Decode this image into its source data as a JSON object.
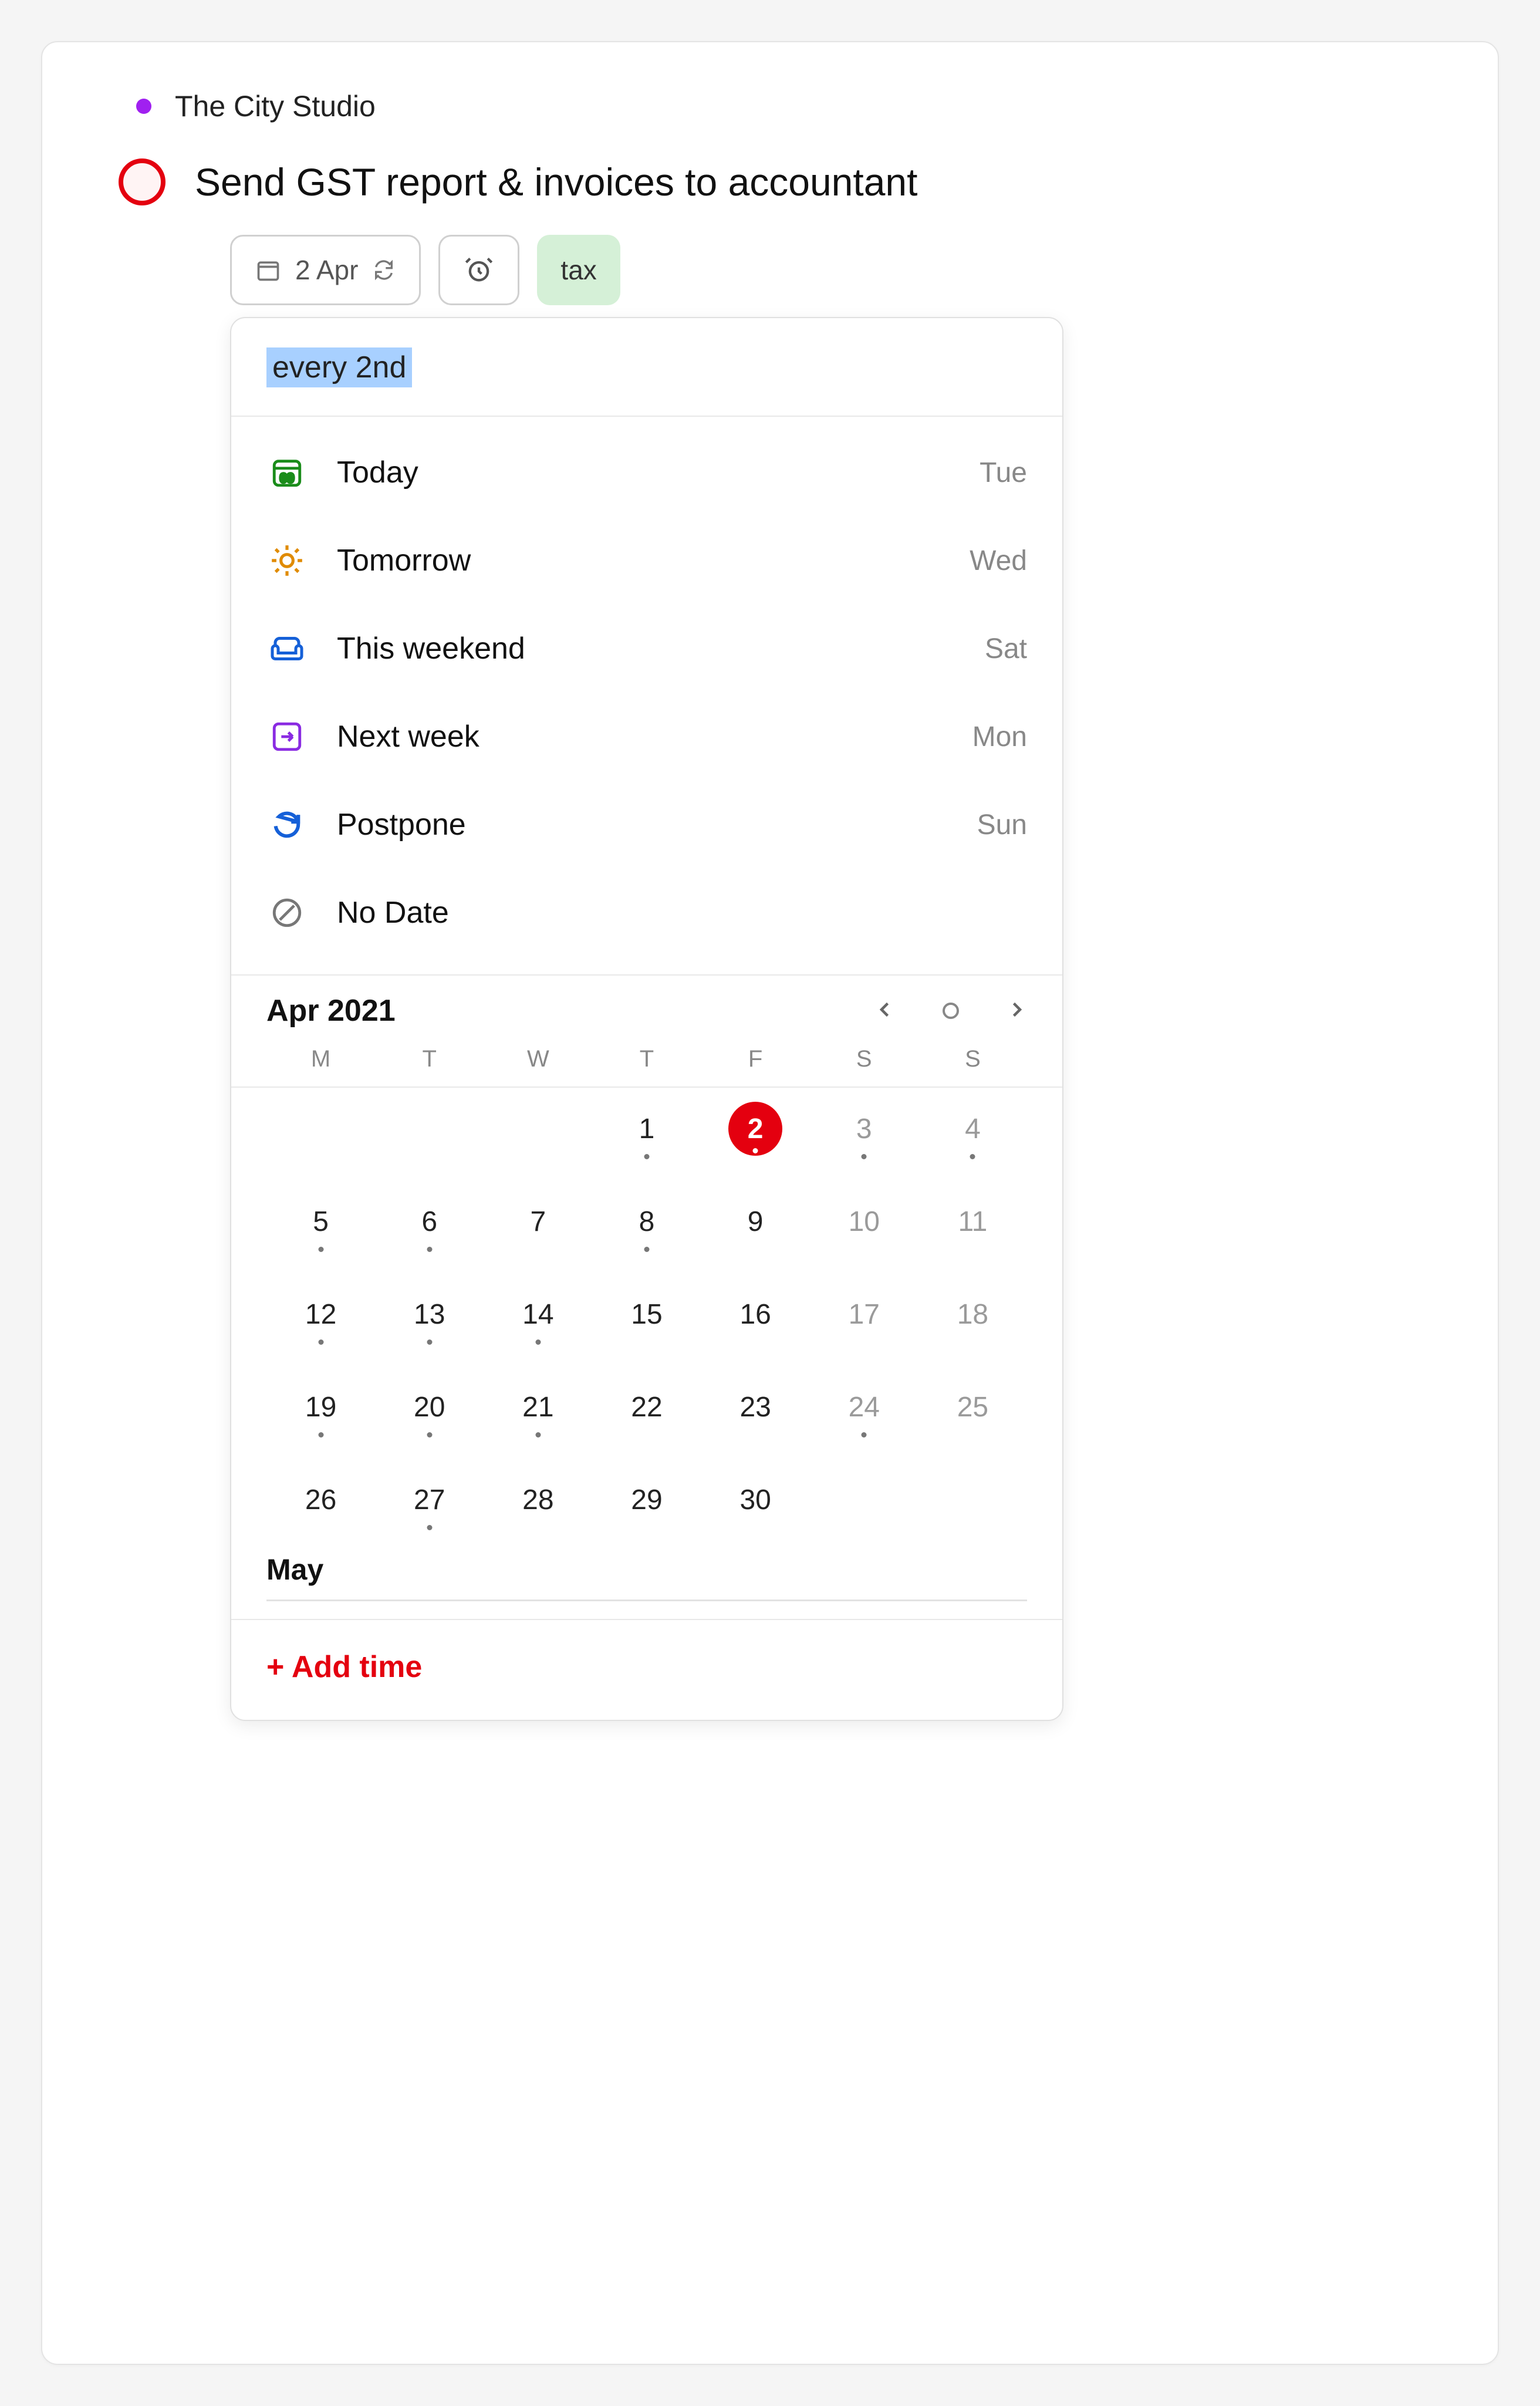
{
  "project": {
    "name": "The City Studio",
    "dot_color": "#a020f0"
  },
  "task": {
    "title": "Send GST report & invoices to accountant",
    "date_chip": "2 Apr",
    "tag": "tax"
  },
  "date_picker": {
    "input_text": "every 2nd",
    "quick": [
      {
        "icon": "today",
        "label": "Today",
        "day": "Tue"
      },
      {
        "icon": "sun",
        "label": "Tomorrow",
        "day": "Wed"
      },
      {
        "icon": "sofa",
        "label": "This weekend",
        "day": "Sat"
      },
      {
        "icon": "nextweek",
        "label": "Next week",
        "day": "Mon"
      },
      {
        "icon": "postpone",
        "label": "Postpone",
        "day": "Sun"
      },
      {
        "icon": "nodate",
        "label": "No Date",
        "day": ""
      }
    ],
    "calendar": {
      "title": "Apr 2021",
      "weekdays": [
        "M",
        "T",
        "W",
        "T",
        "F",
        "S",
        "S"
      ],
      "days": [
        {
          "n": "",
          "wknd": false,
          "dot": false,
          "sel": false
        },
        {
          "n": "",
          "wknd": false,
          "dot": false,
          "sel": false
        },
        {
          "n": "",
          "wknd": false,
          "dot": false,
          "sel": false
        },
        {
          "n": "1",
          "wknd": false,
          "dot": true,
          "sel": false
        },
        {
          "n": "2",
          "wknd": false,
          "dot": true,
          "sel": true
        },
        {
          "n": "3",
          "wknd": true,
          "dot": true,
          "sel": false
        },
        {
          "n": "4",
          "wknd": true,
          "dot": true,
          "sel": false
        },
        {
          "n": "5",
          "wknd": false,
          "dot": true,
          "sel": false
        },
        {
          "n": "6",
          "wknd": false,
          "dot": true,
          "sel": false
        },
        {
          "n": "7",
          "wknd": false,
          "dot": false,
          "sel": false
        },
        {
          "n": "8",
          "wknd": false,
          "dot": true,
          "sel": false
        },
        {
          "n": "9",
          "wknd": false,
          "dot": false,
          "sel": false
        },
        {
          "n": "10",
          "wknd": true,
          "dot": false,
          "sel": false
        },
        {
          "n": "11",
          "wknd": true,
          "dot": false,
          "sel": false
        },
        {
          "n": "12",
          "wknd": false,
          "dot": true,
          "sel": false
        },
        {
          "n": "13",
          "wknd": false,
          "dot": true,
          "sel": false
        },
        {
          "n": "14",
          "wknd": false,
          "dot": true,
          "sel": false
        },
        {
          "n": "15",
          "wknd": false,
          "dot": false,
          "sel": false
        },
        {
          "n": "16",
          "wknd": false,
          "dot": false,
          "sel": false
        },
        {
          "n": "17",
          "wknd": true,
          "dot": false,
          "sel": false
        },
        {
          "n": "18",
          "wknd": true,
          "dot": false,
          "sel": false
        },
        {
          "n": "19",
          "wknd": false,
          "dot": true,
          "sel": false
        },
        {
          "n": "20",
          "wknd": false,
          "dot": true,
          "sel": false
        },
        {
          "n": "21",
          "wknd": false,
          "dot": true,
          "sel": false
        },
        {
          "n": "22",
          "wknd": false,
          "dot": false,
          "sel": false
        },
        {
          "n": "23",
          "wknd": false,
          "dot": false,
          "sel": false
        },
        {
          "n": "24",
          "wknd": true,
          "dot": true,
          "sel": false
        },
        {
          "n": "25",
          "wknd": true,
          "dot": false,
          "sel": false
        },
        {
          "n": "26",
          "wknd": false,
          "dot": false,
          "sel": false
        },
        {
          "n": "27",
          "wknd": false,
          "dot": true,
          "sel": false
        },
        {
          "n": "28",
          "wknd": false,
          "dot": false,
          "sel": false
        },
        {
          "n": "29",
          "wknd": false,
          "dot": false,
          "sel": false
        },
        {
          "n": "30",
          "wknd": false,
          "dot": false,
          "sel": false
        },
        {
          "n": "",
          "wknd": true,
          "dot": false,
          "sel": false
        },
        {
          "n": "",
          "wknd": true,
          "dot": false,
          "sel": false
        }
      ],
      "next_month": "May"
    },
    "add_time": "+ Add time"
  }
}
